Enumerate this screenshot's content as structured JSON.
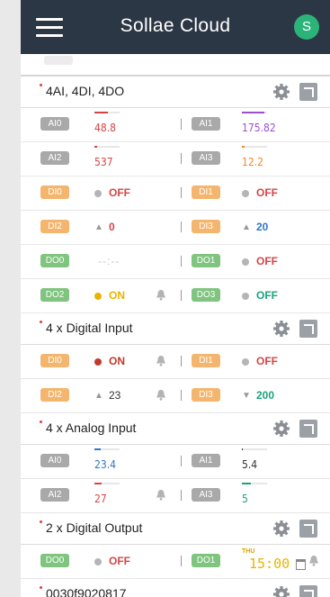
{
  "header": {
    "brand": "Sollae Cloud",
    "avatar_initial": "S"
  },
  "cards": [
    {
      "title": "4AI, 4DI, 4DO",
      "analog": [
        {
          "label": "AI0",
          "value": "48.8",
          "color": "#d64545",
          "fraction": 0.55
        },
        {
          "label": "AI1",
          "value": "175.82",
          "color": "#9b4fd1",
          "fraction": 0.9
        },
        {
          "label": "AI2",
          "value": "537",
          "color": "#d64545",
          "fraction": 0.12
        },
        {
          "label": "AI3",
          "value": "12.2",
          "color": "#f08a24",
          "fraction": 0.12
        }
      ],
      "digital_in": [
        {
          "label": "DI0",
          "state": "OFF"
        },
        {
          "label": "DI1",
          "state": "OFF"
        }
      ],
      "counters": [
        {
          "label": "DI2",
          "count": "0",
          "color": "#d64545"
        },
        {
          "label": "DI3",
          "count": "20",
          "color": "#2f76c6"
        }
      ],
      "outputs": [
        {
          "label": "DO0",
          "placeholder": "--:--"
        },
        {
          "label": "DO1",
          "state": "OFF"
        },
        {
          "label": "DO2",
          "state": "ON"
        },
        {
          "label": "DO3",
          "state": "OFF"
        }
      ]
    },
    {
      "title": "4 x Digital Input",
      "inputs": [
        {
          "label": "DI0",
          "state": "ON"
        },
        {
          "label": "DI1",
          "state": "OFF"
        }
      ],
      "counters": [
        {
          "label": "DI2",
          "count": "23"
        },
        {
          "label": "DI3",
          "count": "200"
        }
      ]
    },
    {
      "title": "4 x Analog Input",
      "analog": [
        {
          "label": "AI0",
          "value": "23.4",
          "color": "#2f76c6",
          "fraction": 0.25
        },
        {
          "label": "AI1",
          "value": "5.4",
          "color": "#333333",
          "fraction": 0.05
        },
        {
          "label": "AI2",
          "value": "27",
          "color": "#d64545",
          "fraction": 0.3
        },
        {
          "label": "AI3",
          "value": "5",
          "color": "#1aa37a",
          "fraction": 0.35
        }
      ]
    },
    {
      "title": "2 x Digital Output",
      "outputs": [
        {
          "label": "DO0",
          "state": "OFF"
        },
        {
          "label": "DO1",
          "day": "THU",
          "time": "15:00"
        }
      ]
    },
    {
      "title": "0030f9020817"
    }
  ]
}
